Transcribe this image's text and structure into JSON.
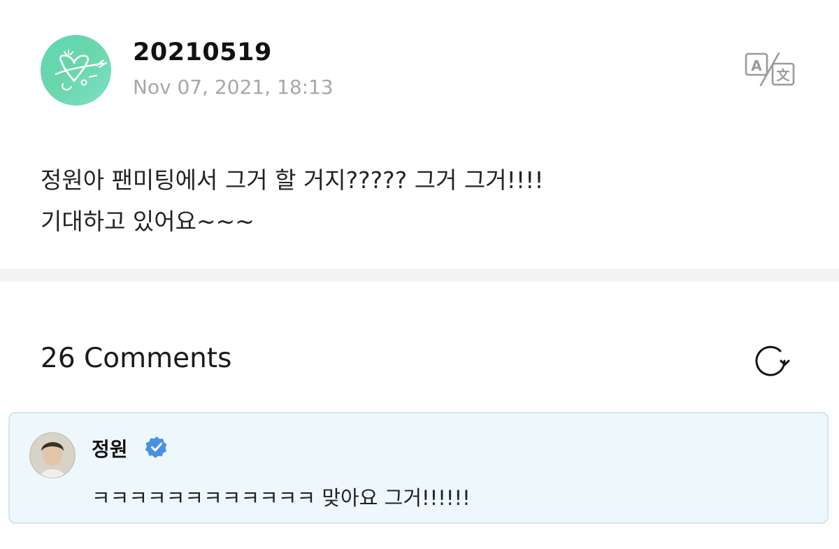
{
  "post": {
    "author_name": "20210519",
    "date": "Nov 07, 2021, 18:13",
    "body_lines": [
      "정원아 팬미팅에서 그거 할 거지????? 그거 그거!!!!",
      "기대하고 있어요~~~"
    ],
    "translate_icon": "translate-icon",
    "avatar_icon": "heart-doodle-icon"
  },
  "comments": {
    "title": "26 Comments",
    "refresh_icon": "refresh-icon",
    "items": [
      {
        "author": "정원",
        "verified": true,
        "text": "ㅋㅋㅋㅋㅋㅋㅋㅋㅋㅋㅋㅋ 맞아요 그거!!!!!!"
      }
    ]
  },
  "colors": {
    "accent_verified": "#4a90e2",
    "avatar_mint": "#69d6a9",
    "comment_card_bg": "#eef8fc",
    "date_gray": "#a7a7a7"
  }
}
